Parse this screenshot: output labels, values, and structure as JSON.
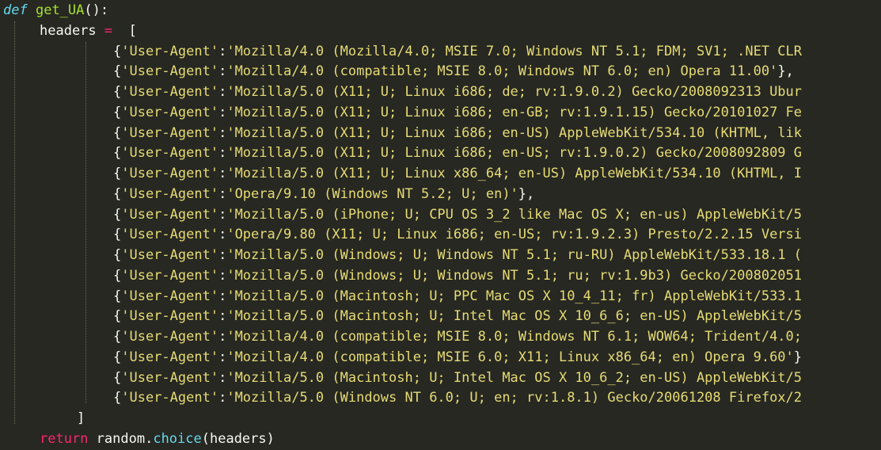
{
  "code": {
    "def_keyword": "def",
    "function_name": "get_UA",
    "function_tail": "():",
    "assign_var": "headers",
    "assign_op": "=",
    "open_bracket": "[",
    "entries": [
      {
        "key": "'User-Agent'",
        "value": "'Mozilla/4.0 (Mozilla/4.0; MSIE 7.0; Windows NT 5.1; FDM; SV1; .NET CLR"
      },
      {
        "key": "'User-Agent'",
        "value": "'Mozilla/4.0 (compatible; MSIE 8.0; Windows NT 6.0; en) Opera 11.00'",
        "tail": "},"
      },
      {
        "key": "'User-Agent'",
        "value": "'Mozilla/5.0 (X11; U; Linux i686; de; rv:1.9.0.2) Gecko/2008092313 Ubur"
      },
      {
        "key": "'User-Agent'",
        "value": "'Mozilla/5.0 (X11; U; Linux i686; en-GB; rv:1.9.1.15) Gecko/20101027 Fe"
      },
      {
        "key": "'User-Agent'",
        "value": "'Mozilla/5.0 (X11; U; Linux i686; en-US) AppleWebKit/534.10 (KHTML, lik"
      },
      {
        "key": "'User-Agent'",
        "value": "'Mozilla/5.0 (X11; U; Linux i686; en-US; rv:1.9.0.2) Gecko/2008092809 G"
      },
      {
        "key": "'User-Agent'",
        "value": "'Mozilla/5.0 (X11; U; Linux x86_64; en-US) AppleWebKit/534.10 (KHTML, I"
      },
      {
        "key": "'User-Agent'",
        "value": "'Opera/9.10 (Windows NT 5.2; U; en)'",
        "tail": "},"
      },
      {
        "key": "'User-Agent'",
        "value": "'Mozilla/5.0 (iPhone; U; CPU OS 3_2 like Mac OS X; en-us) AppleWebKit/5"
      },
      {
        "key": "'User-Agent'",
        "value": "'Opera/9.80 (X11; U; Linux i686; en-US; rv:1.9.2.3) Presto/2.2.15 Versi"
      },
      {
        "key": "'User-Agent'",
        "value": "'Mozilla/5.0 (Windows; U; Windows NT 5.1; ru-RU) AppleWebKit/533.18.1 ("
      },
      {
        "key": "'User-Agent'",
        "value": "'Mozilla/5.0 (Windows; U; Windows NT 5.1; ru; rv:1.9b3) Gecko/200802051"
      },
      {
        "key": "'User-Agent'",
        "value": "'Mozilla/5.0 (Macintosh; U; PPC Mac OS X 10_4_11; fr) AppleWebKit/533.1"
      },
      {
        "key": "'User-Agent'",
        "value": "'Mozilla/5.0 (Macintosh; U; Intel Mac OS X 10_6_6; en-US) AppleWebKit/5"
      },
      {
        "key": "'User-Agent'",
        "value": "'Mozilla/4.0 (compatible; MSIE 8.0; Windows NT 6.1; WOW64; Trident/4.0;"
      },
      {
        "key": "'User-Agent'",
        "value": "'Mozilla/4.0 (compatible; MSIE 6.0; X11; Linux x86_64; en) Opera 9.60'",
        "tail": "}"
      },
      {
        "key": "'User-Agent'",
        "value": "'Mozilla/5.0 (Macintosh; U; Intel Mac OS X 10_6_2; en-US) AppleWebKit/5"
      },
      {
        "key": "'User-Agent'",
        "value": "'Mozilla/5.0 (Windows NT 6.0; U; en; rv:1.8.1) Gecko/20061208 Firefox/2"
      }
    ],
    "close_bracket": "]",
    "return_keyword": "return",
    "return_expr_head": "random.",
    "return_method": "choice",
    "return_expr_tail": "(headers)"
  },
  "colors": {
    "background": "#272822",
    "keyword_def": "#66d9ef",
    "function_name": "#a6e22e",
    "keyword_return": "#f92672",
    "string": "#e6db74",
    "text": "#f8f8f2"
  }
}
